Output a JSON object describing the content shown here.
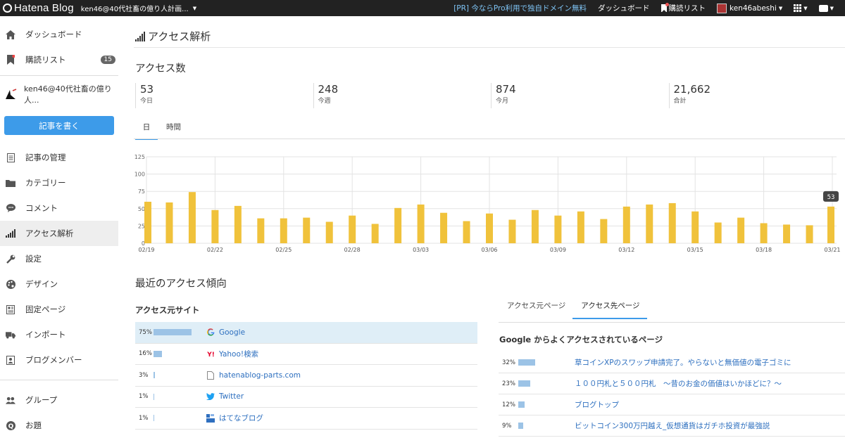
{
  "topbar": {
    "logo_text": "Hatena Blog",
    "blog_selector": "ken46@40代社畜の億り人計画...",
    "pr_link": "[PR] 今ならPro利用で独自ドメイン無料",
    "dashboard": "ダッシュボード",
    "reading_list": "購読リスト",
    "user": "ken46abeshi"
  },
  "sidebar": {
    "items_top": [
      {
        "label": "ダッシュボード",
        "icon": "home-icon"
      },
      {
        "label": "購読リスト",
        "icon": "bookmark-icon",
        "badge": "15"
      }
    ],
    "blog_name": "ken46@40代社畜の億り人...",
    "write_button": "記事を書く",
    "items_main": [
      {
        "label": "記事の管理",
        "icon": "document-icon"
      },
      {
        "label": "カテゴリー",
        "icon": "folder-icon"
      },
      {
        "label": "コメント",
        "icon": "comment-icon"
      },
      {
        "label": "アクセス解析",
        "icon": "bars-icon",
        "active": true
      },
      {
        "label": "設定",
        "icon": "wrench-icon"
      },
      {
        "label": "デザイン",
        "icon": "palette-icon"
      },
      {
        "label": "固定ページ",
        "icon": "page-icon"
      },
      {
        "label": "インポート",
        "icon": "truck-icon"
      },
      {
        "label": "ブログメンバー",
        "icon": "member-icon"
      }
    ],
    "items_bottom": [
      {
        "label": "グループ",
        "icon": "group-icon"
      },
      {
        "label": "お題",
        "icon": "question-icon"
      }
    ]
  },
  "main": {
    "title": "アクセス解析",
    "access_heading": "アクセス数",
    "stats": [
      {
        "value": "53",
        "label": "今日"
      },
      {
        "value": "248",
        "label": "今週"
      },
      {
        "value": "874",
        "label": "今月"
      },
      {
        "value": "21,662",
        "label": "合計"
      }
    ],
    "tabs": [
      "日",
      "時間"
    ],
    "trend_heading": "最近のアクセス傾向",
    "referrer_heading": "アクセス元サイト",
    "referrers": [
      {
        "pct": "75%",
        "value": 75,
        "name": "Google",
        "icon": "google-icon",
        "highlight": true
      },
      {
        "pct": "16%",
        "value": 16,
        "name": "Yahoo!検索",
        "icon": "yahoo-icon"
      },
      {
        "pct": "3%",
        "value": 3,
        "name": "hatenablog-parts.com",
        "icon": "page-icon"
      },
      {
        "pct": "1%",
        "value": 1,
        "name": "Twitter",
        "icon": "twitter-icon"
      },
      {
        "pct": "1%",
        "value": 1,
        "name": "はてなブログ",
        "icon": "hatena-icon"
      }
    ],
    "right_tabs": [
      "アクセス元ページ",
      "アクセス先ページ"
    ],
    "dest_heading": "Google からよくアクセスされているページ",
    "destinations": [
      {
        "pct": "32%",
        "value": 32,
        "name": "草コインXPのスワップ申請完了。やらないと無価値の電子ゴミに"
      },
      {
        "pct": "23%",
        "value": 23,
        "name": "１００円札と５００円札　～昔のお金の価値はいかほどに？～"
      },
      {
        "pct": "12%",
        "value": 12,
        "name": "ブログトップ"
      },
      {
        "pct": "9%",
        "value": 9,
        "name": "ビットコイン300万円越え_仮想通貨はガチホ投資が最強説"
      }
    ]
  },
  "chart_data": {
    "type": "bar",
    "color": "#f0c23b",
    "ylim": [
      0,
      125
    ],
    "yticks": [
      0,
      25,
      50,
      75,
      100,
      125
    ],
    "categories": [
      "02/19",
      "02/20",
      "02/21",
      "02/22",
      "02/23",
      "02/24",
      "02/25",
      "02/26",
      "02/27",
      "02/28",
      "03/01",
      "03/02",
      "03/03",
      "03/04",
      "03/05",
      "03/06",
      "03/07",
      "03/08",
      "03/09",
      "03/10",
      "03/11",
      "03/12",
      "03/13",
      "03/14",
      "03/15",
      "03/16",
      "03/17",
      "03/18",
      "03/19",
      "03/20",
      "03/21"
    ],
    "tick_labels": [
      "02/19",
      "02/22",
      "02/25",
      "02/28",
      "03/03",
      "03/06",
      "03/09",
      "03/12",
      "03/15",
      "03/18",
      "03/21"
    ],
    "values": [
      60,
      59,
      74,
      48,
      54,
      36,
      36,
      37,
      31,
      40,
      28,
      51,
      56,
      44,
      32,
      43,
      34,
      48,
      40,
      46,
      35,
      53,
      56,
      58,
      46,
      30,
      37,
      29,
      27,
      26,
      53
    ],
    "tooltip": "53"
  }
}
